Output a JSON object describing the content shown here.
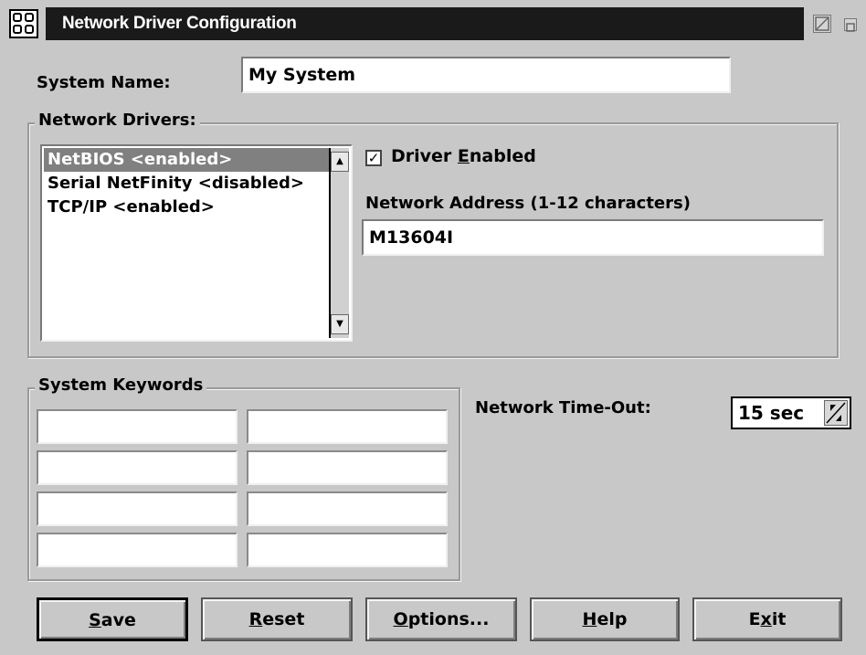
{
  "window": {
    "title": "Network Driver Configuration"
  },
  "system_name": {
    "label": "System Name:",
    "value": "My System"
  },
  "network_drivers": {
    "group_title": "Network Drivers:",
    "items": [
      {
        "label": "NetBIOS <enabled>",
        "selected": true
      },
      {
        "label": "Serial NetFinity <disabled>",
        "selected": false
      },
      {
        "label": "TCP/IP <enabled>",
        "selected": false
      }
    ],
    "driver_enabled": {
      "checked": true,
      "check_glyph": "✓",
      "label_pre": "Driver ",
      "label_mnemonic": "E",
      "label_post": "nabled"
    },
    "address_label": "Network Address (1-12 characters)",
    "address_value": "M13604I"
  },
  "system_keywords": {
    "group_title": "System Keywords",
    "cells": [
      "",
      "",
      "",
      "",
      "",
      "",
      "",
      ""
    ]
  },
  "timeout": {
    "label": "Network Time-Out:",
    "value": "15 sec"
  },
  "buttons": {
    "save": {
      "mnemonic": "S",
      "rest": "ave"
    },
    "reset": {
      "mnemonic": "R",
      "rest": "eset"
    },
    "options": {
      "mnemonic": "O",
      "rest": "ptions..."
    },
    "help": {
      "mnemonic": "H",
      "rest": "elp"
    },
    "exit": {
      "pre": "E",
      "mnemonic": "x",
      "rest": "it"
    }
  }
}
